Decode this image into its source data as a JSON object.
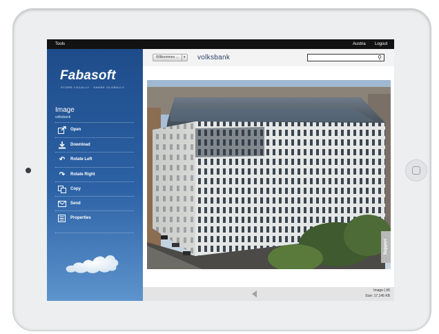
{
  "topbar": {
    "tools": "Tools",
    "region": "Austria",
    "logout": "Logout"
  },
  "sidebar": {
    "logo": "Fabasoft",
    "tagline": "STORE LOCALLY · SHARE GLOBALLY",
    "section_title": "Image",
    "section_subtitle": "volksbank",
    "actions": [
      {
        "label": "Open",
        "icon": "open-external-icon"
      },
      {
        "label": "Download",
        "icon": "download-icon"
      },
      {
        "label": "Rotate Left",
        "icon": "rotate-left-icon"
      },
      {
        "label": "Rotate Right",
        "icon": "rotate-right-icon"
      },
      {
        "label": "Copy",
        "icon": "copy-icon"
      },
      {
        "label": "Send",
        "icon": "envelope-icon"
      },
      {
        "label": "Properties",
        "icon": "properties-icon"
      }
    ]
  },
  "header": {
    "breadcrumb": "Willkommen ...",
    "title": "volksbank",
    "search_placeholder": ""
  },
  "support_tab": "Support",
  "footer": {
    "file_type": "Image (.tif)",
    "file_size": "Size: 17,145 KB"
  },
  "colors": {
    "sidebar_blue": "#1e4c8a",
    "topbar": "#121212",
    "title": "#2a3f6a"
  }
}
